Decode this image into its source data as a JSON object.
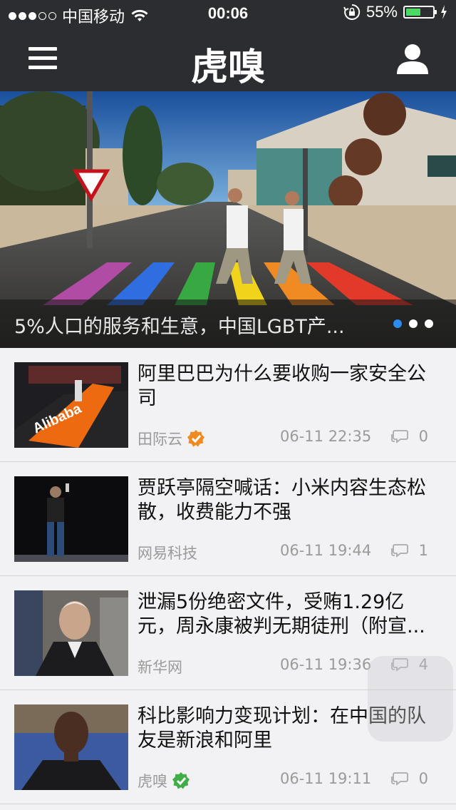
{
  "status_bar": {
    "carrier": "中国移动",
    "time": "00:06",
    "battery": "55%",
    "battery_level": 0.55
  },
  "nav": {
    "title": "虎嗅"
  },
  "hero": {
    "caption": "5%人口的服务和生意，中国LGBT产...",
    "page_count": 3,
    "active_page": 1
  },
  "articles": [
    {
      "title": "阿里巴巴为什么要收购一家安全公司",
      "source": "田际云",
      "time": "06-11 22:35",
      "comments": "0",
      "verified": "orange"
    },
    {
      "title": "贾跃亭隔空喊话：小米内容生态松散，收费能力不强",
      "source": "网易科技",
      "time": "06-11 19:44",
      "comments": "1",
      "verified": ""
    },
    {
      "title": "泄漏5份绝密文件，受贿1.29亿元，周永康被判无期徒刑（附宣...",
      "source": "新华网",
      "time": "06-11 19:36",
      "comments": "4",
      "verified": ""
    },
    {
      "title": "科比影响力变现计划：在中国的队友是新浪和阿里",
      "source": "虎嗅",
      "time": "06-11 19:11",
      "comments": "0",
      "verified": "green"
    }
  ]
}
